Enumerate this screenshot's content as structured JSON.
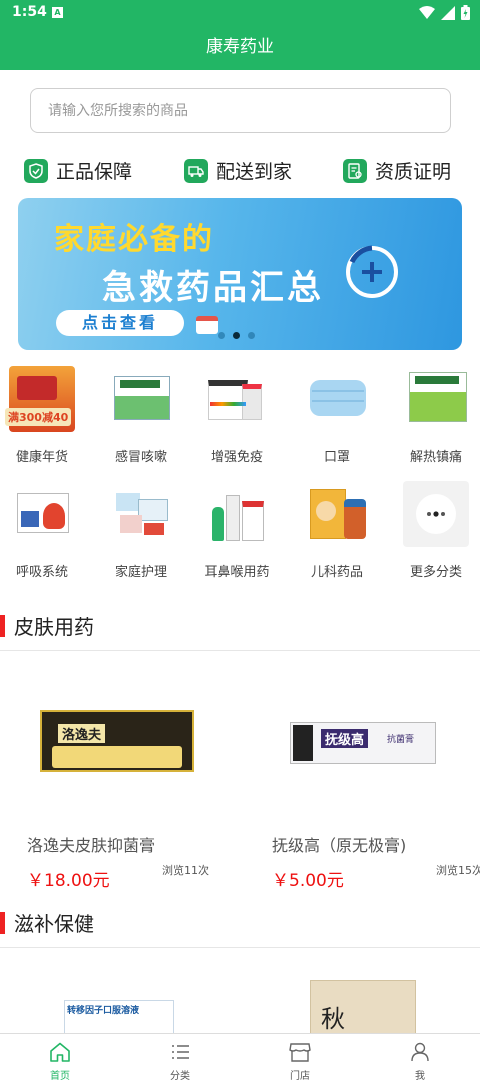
{
  "status_bar": {
    "time": "1:54",
    "sim_label": "A"
  },
  "app_title": "康寿药业",
  "search": {
    "placeholder": "请输入您所搜索的商品"
  },
  "features": [
    {
      "label": "正品保障",
      "icon": "shield-check-icon"
    },
    {
      "label": "配送到家",
      "icon": "delivery-truck-icon"
    },
    {
      "label": "资质证明",
      "icon": "certificate-icon"
    }
  ],
  "banner": {
    "line1": "家庭必备的",
    "line2": "急救药品汇总",
    "button": "点击查看",
    "slide_count": 3,
    "active_slide": 2
  },
  "categories": [
    {
      "label": "健康年货",
      "icon": "gift-box-icon",
      "tag": "满300减40"
    },
    {
      "label": "感冒咳嗽",
      "icon": "cold-medicine-box-icon"
    },
    {
      "label": "增强免疫",
      "icon": "vitamin-box-icon"
    },
    {
      "label": "口罩",
      "icon": "face-mask-icon"
    },
    {
      "label": "解热镇痛",
      "icon": "fever-medicine-box-icon"
    },
    {
      "label": "呼吸系统",
      "icon": "respiratory-medicine-box-icon"
    },
    {
      "label": "家庭护理",
      "icon": "first-aid-kit-icon"
    },
    {
      "label": "耳鼻喉用药",
      "icon": "nasal-spray-icon"
    },
    {
      "label": "儿科药品",
      "icon": "children-syrup-icon"
    },
    {
      "label": "更多分类",
      "icon": "more-dots-icon"
    }
  ],
  "sections": [
    {
      "title": "皮肤用药",
      "products": [
        {
          "name": "洛逸夫皮肤抑菌膏",
          "price": "￥18.00元",
          "views": "浏览11次",
          "pack_text": "洛逸夫"
        },
        {
          "name": "抚级高（原无极膏)",
          "price": "￥5.00元",
          "views": "浏览15次",
          "pack_text": "抚级高",
          "pack_sub": "抗菌膏"
        }
      ]
    },
    {
      "title": "滋补保健",
      "products": [
        {
          "name": "",
          "pack_text": "转移因子口服溶液"
        },
        {
          "name": "",
          "pack_text": "秋"
        }
      ]
    }
  ],
  "tabbar": [
    {
      "label": "首页",
      "icon": "home-icon",
      "active": true
    },
    {
      "label": "分类",
      "icon": "list-icon",
      "active": false
    },
    {
      "label": "门店",
      "icon": "store-icon",
      "active": false
    },
    {
      "label": "我",
      "icon": "user-icon",
      "active": false
    }
  ],
  "colors": {
    "brand": "#22b665",
    "price": "#e11111",
    "section_bar": "#e22222"
  }
}
